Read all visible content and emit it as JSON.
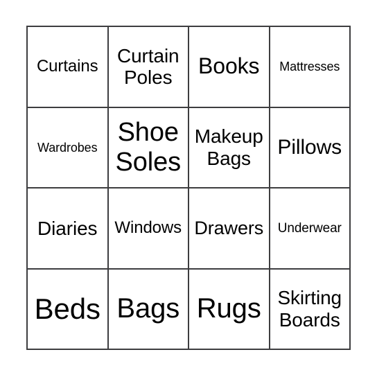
{
  "card": {
    "type": "bingo-card",
    "columns": 4,
    "rows": 4,
    "background_color": "#ffffff",
    "border_color": "#3d3d3f",
    "text_color": "#000000",
    "cells": [
      {
        "label": "Curtains",
        "row": 1,
        "col": 1,
        "font_px": 24,
        "lines": 1
      },
      {
        "label": "Curtain Poles",
        "row": 1,
        "col": 2,
        "font_px": 28,
        "lines": 2
      },
      {
        "label": "Books",
        "row": 1,
        "col": 3,
        "font_px": 32,
        "lines": 1
      },
      {
        "label": "Mattresses",
        "row": 1,
        "col": 4,
        "font_px": 18,
        "lines": 1
      },
      {
        "label": "Wardrobes",
        "row": 2,
        "col": 1,
        "font_px": 18,
        "lines": 1
      },
      {
        "label": "Shoe Soles",
        "row": 2,
        "col": 2,
        "font_px": 38,
        "lines": 2
      },
      {
        "label": "Makeup Bags",
        "row": 2,
        "col": 3,
        "font_px": 28,
        "lines": 2
      },
      {
        "label": "Pillows",
        "row": 2,
        "col": 4,
        "font_px": 30,
        "lines": 1
      },
      {
        "label": "Diaries",
        "row": 3,
        "col": 1,
        "font_px": 28,
        "lines": 1
      },
      {
        "label": "Windows",
        "row": 3,
        "col": 2,
        "font_px": 24,
        "lines": 1
      },
      {
        "label": "Drawers",
        "row": 3,
        "col": 3,
        "font_px": 27,
        "lines": 1
      },
      {
        "label": "Underwear",
        "row": 3,
        "col": 4,
        "font_px": 19,
        "lines": 1
      },
      {
        "label": "Beds",
        "row": 4,
        "col": 1,
        "font_px": 42,
        "lines": 1
      },
      {
        "label": "Bags",
        "row": 4,
        "col": 2,
        "font_px": 40,
        "lines": 1
      },
      {
        "label": "Rugs",
        "row": 4,
        "col": 3,
        "font_px": 40,
        "lines": 1
      },
      {
        "label": "Skirting Boards",
        "row": 4,
        "col": 4,
        "font_px": 28,
        "lines": 2
      }
    ]
  }
}
